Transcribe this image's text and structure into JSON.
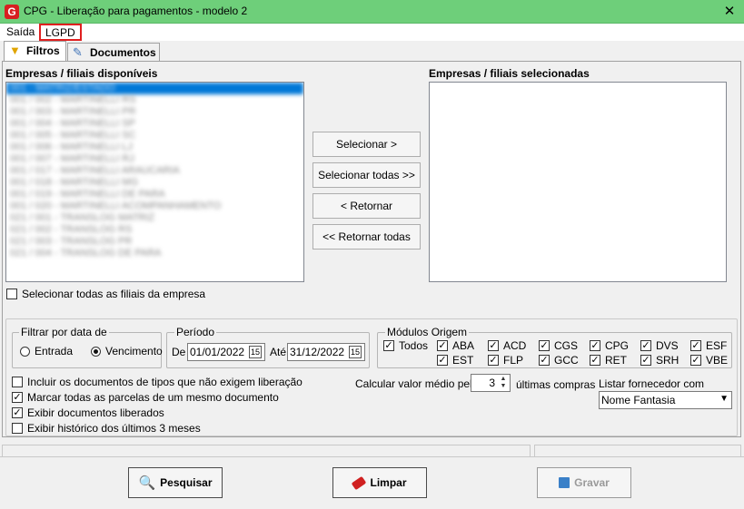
{
  "window": {
    "title": "CPG - Liberação para pagamentos - modelo 2",
    "app_icon": "G"
  },
  "menu": {
    "saida": "Saída",
    "lgpd": "LGPD"
  },
  "tabs": {
    "filtros": "Filtros",
    "documentos": "Documentos"
  },
  "lists": {
    "available_label": "Empresas / filiais disponíveis",
    "selected_label": "Empresas / filiais selecionadas",
    "available_items": [
      "001 - MATRIZ/ESTADO",
      "001 / 002 - MARTINELLI RS",
      "001 / 003 - MARTINELLI PR",
      "001 / 004 - MARTINELLI SP",
      "001 / 005 - MARTINELLI SC",
      "001 / 006 - MARTINELLI LJ",
      "001 / 007 - MARTINELLI RJ",
      "001 / 017 - MARTINELLI ARAUCARIA",
      "001 / 018 - MARTINELLI MG",
      "001 / 019 - MARTINELLI DE PARA",
      "001 / 020 - MARTINELLI ACOMPANHAMENTO",
      "021 / 001 - TRANSLOG MATRIZ",
      "021 / 002 - TRANSLOG RS",
      "021 / 003 - TRANSLOG PR",
      "021 / 004 - TRANSLOG DE PARA"
    ]
  },
  "buttons": {
    "selecionar": "Selecionar >",
    "selecionar_todas": "Selecionar todas >>",
    "retornar": "< Retornar",
    "retornar_todas": "<< Retornar todas",
    "pesquisar": "Pesquisar",
    "limpar": "Limpar",
    "gravar": "Gravar"
  },
  "select_all_branches": {
    "label": "Selecionar todas as filiais da empresa",
    "checked": false
  },
  "filtrar_data": {
    "title": "Filtrar por data de",
    "entrada": "Entrada",
    "vencimento": "Vencimento",
    "selected": "Vencimento"
  },
  "periodo": {
    "title": "Período",
    "de_label": "De",
    "de_value": "01/01/2022",
    "ate_label": "Até",
    "ate_value": "31/12/2022",
    "cal_label": "15"
  },
  "modulos": {
    "title": "Módulos Origem",
    "todos": "Todos",
    "items": [
      "ABA",
      "ACD",
      "CGS",
      "CPG",
      "DVS",
      "ESF",
      "EST",
      "FLP",
      "GCC",
      "RET",
      "SRH",
      "VBE"
    ]
  },
  "options": [
    {
      "label": "Incluir os documentos de tipos que não exigem liberação",
      "checked": false
    },
    {
      "label": "Marcar todas as parcelas de um mesmo documento",
      "checked": true
    },
    {
      "label": "Exibir documentos liberados",
      "checked": true
    },
    {
      "label": "Exibir histórico dos últimos 3 meses",
      "checked": false
    }
  ],
  "media": {
    "prefix": "Calcular valor médio pelas",
    "value": "3",
    "suffix": "últimas compras"
  },
  "fornecedor": {
    "label": "Listar fornecedor com",
    "value": "Nome Fantasia"
  }
}
